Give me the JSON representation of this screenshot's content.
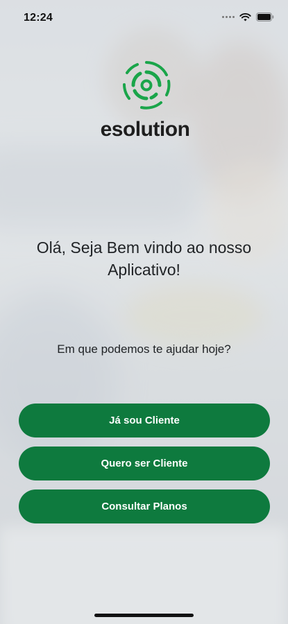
{
  "status_bar": {
    "time": "12:24"
  },
  "brand": {
    "name": "esolution",
    "accent_color": "#1aa54a"
  },
  "welcome_text": "Olá, Seja Bem vindo ao nosso Aplicativo!",
  "question_text": "Em que podemos te ajudar hoje?",
  "buttons": [
    {
      "label": "Já sou Cliente"
    },
    {
      "label": "Quero ser Cliente"
    },
    {
      "label": "Consultar Planos"
    }
  ],
  "colors": {
    "button_bg": "#0e7a3e",
    "button_text": "#ffffff"
  },
  "icons": [
    "signal-dots-icon",
    "wifi-icon",
    "battery-icon"
  ]
}
